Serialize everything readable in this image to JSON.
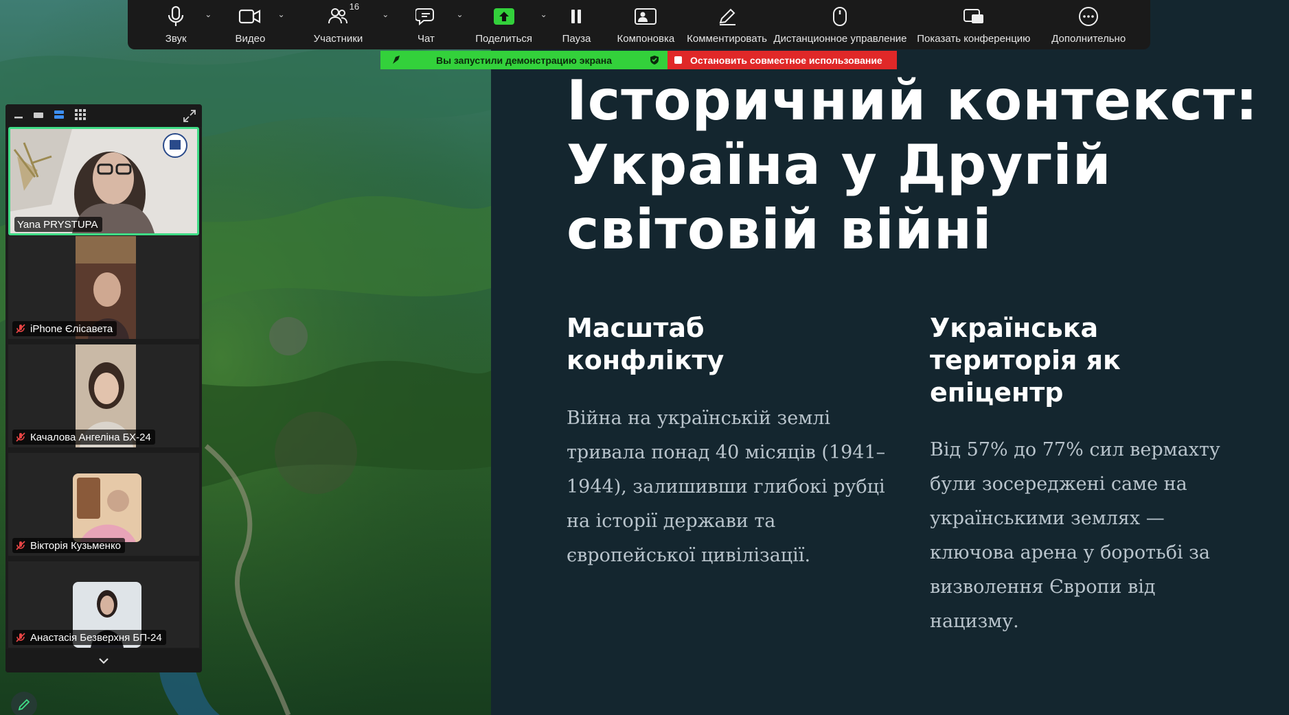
{
  "toolbar": {
    "audio_label": "Звук",
    "video_label": "Видео",
    "participants_label": "Участники",
    "participants_count": "16",
    "chat_label": "Чат",
    "share_label": "Поделиться",
    "pause_label": "Пауза",
    "layout_label": "Компоновка",
    "annotate_label": "Комментировать",
    "remote_label": "Дистанционное управление",
    "show_meeting_label": "Показать конференцию",
    "more_label": "Дополнительно"
  },
  "share_banner": {
    "status": "Вы запустили демонстрацию экрана",
    "stop": "Остановить совместное использование"
  },
  "gallery": {
    "tiles": [
      {
        "name": "Yana PRYSTUPA",
        "muted": false
      },
      {
        "name": "iPhone Єлісавета",
        "muted": true
      },
      {
        "name": "Качалова Ангеліна БХ-24",
        "muted": true
      },
      {
        "name": "Вікторія Кузьменко",
        "muted": true
      },
      {
        "name": "Анастасія Безверхня БП-24",
        "muted": true
      }
    ]
  },
  "slide": {
    "title_line1": "Історичний контекст:",
    "title_line2": "Україна у Другій",
    "title_line3": "світовій війні",
    "col1_heading_line1": "Масштаб",
    "col1_heading_line2": "конфлікту",
    "col1_lines": [
      "Війна на українській землі",
      "тривала понад 40 місяців (1941–",
      "1944), залишивши глибокі рубці",
      "на історії держави та",
      "європейської цивілізації."
    ],
    "col2_heading_line1": "Українська",
    "col2_heading_line2": "територія як",
    "col2_heading_line3": "епіцентр",
    "col2_lines": [
      "Від 57% до 77% сил вермахту",
      "були зосереджені саме на",
      "українськими землях —",
      "ключова арена у боротьбі за",
      "визволення Європи від",
      "нацизму."
    ]
  },
  "colors": {
    "slide_bg": "#14262f",
    "share_green": "#33d13b",
    "stop_red": "#e02828",
    "active_speaker": "#3fdc86",
    "toolbar_bg": "#1a1a1a"
  }
}
